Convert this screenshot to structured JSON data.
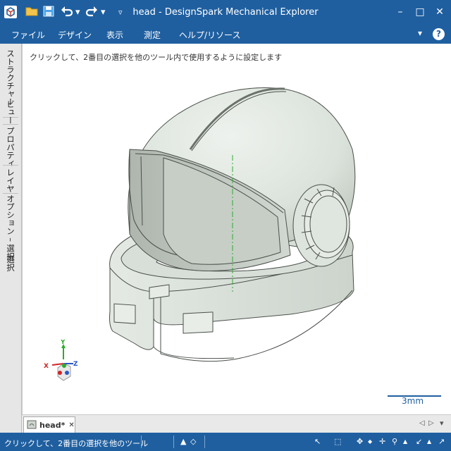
{
  "window": {
    "title": "head - DesignSpark Mechanical Explorer",
    "minimize": "–",
    "maximize": "□",
    "close": "✕"
  },
  "quick_access": {
    "undo_dropdown": "▾",
    "redo_dropdown": "▾",
    "customize": "▿"
  },
  "menu": {
    "items": [
      "ファイル",
      "デザイン",
      "表示",
      "測定",
      "ヘルプ/リソース"
    ],
    "collapse": "▾",
    "help": "?"
  },
  "left_tabs": [
    "ストラクチャー",
    "ビュー",
    "プロパティ",
    "レイヤ",
    "オプション – 選択",
    "選択"
  ],
  "viewport": {
    "hint": "クリックして、2番目の選択を他のツール内で使用するように設定します",
    "scale_label": "3mm",
    "triad": {
      "x": "X",
      "y": "Y",
      "z": "Z"
    },
    "colors": {
      "model_fill": "#dfe5df",
      "model_edge": "#4a4f4a",
      "axis": "#2eaa2e"
    }
  },
  "doc_tabs": {
    "items": [
      {
        "label": "head*",
        "close": "✕"
      }
    ],
    "nav_prev": "◁",
    "nav_next": "▷",
    "menu": "▾"
  },
  "status": {
    "text": "クリックして、2番目の選択を他のツール",
    "icons": [
      "▲",
      "◇",
      "↖",
      "⬚",
      "✥",
      "◆",
      "✛",
      "⚲",
      "▲",
      "↙",
      "▲",
      "↗"
    ]
  }
}
